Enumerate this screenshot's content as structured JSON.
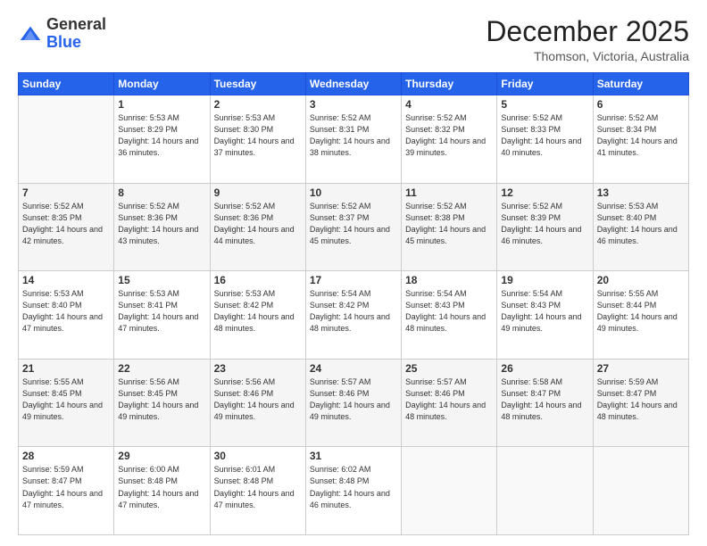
{
  "header": {
    "logo_general": "General",
    "logo_blue": "Blue",
    "month_title": "December 2025",
    "location": "Thomson, Victoria, Australia"
  },
  "weekdays": [
    "Sunday",
    "Monday",
    "Tuesday",
    "Wednesday",
    "Thursday",
    "Friday",
    "Saturday"
  ],
  "weeks": [
    [
      {
        "day": "",
        "sunrise": "",
        "sunset": "",
        "daylight": ""
      },
      {
        "day": "1",
        "sunrise": "5:53 AM",
        "sunset": "8:29 PM",
        "daylight": "14 hours and 36 minutes."
      },
      {
        "day": "2",
        "sunrise": "5:53 AM",
        "sunset": "8:30 PM",
        "daylight": "14 hours and 37 minutes."
      },
      {
        "day": "3",
        "sunrise": "5:52 AM",
        "sunset": "8:31 PM",
        "daylight": "14 hours and 38 minutes."
      },
      {
        "day": "4",
        "sunrise": "5:52 AM",
        "sunset": "8:32 PM",
        "daylight": "14 hours and 39 minutes."
      },
      {
        "day": "5",
        "sunrise": "5:52 AM",
        "sunset": "8:33 PM",
        "daylight": "14 hours and 40 minutes."
      },
      {
        "day": "6",
        "sunrise": "5:52 AM",
        "sunset": "8:34 PM",
        "daylight": "14 hours and 41 minutes."
      }
    ],
    [
      {
        "day": "7",
        "sunrise": "5:52 AM",
        "sunset": "8:35 PM",
        "daylight": "14 hours and 42 minutes."
      },
      {
        "day": "8",
        "sunrise": "5:52 AM",
        "sunset": "8:36 PM",
        "daylight": "14 hours and 43 minutes."
      },
      {
        "day": "9",
        "sunrise": "5:52 AM",
        "sunset": "8:36 PM",
        "daylight": "14 hours and 44 minutes."
      },
      {
        "day": "10",
        "sunrise": "5:52 AM",
        "sunset": "8:37 PM",
        "daylight": "14 hours and 45 minutes."
      },
      {
        "day": "11",
        "sunrise": "5:52 AM",
        "sunset": "8:38 PM",
        "daylight": "14 hours and 45 minutes."
      },
      {
        "day": "12",
        "sunrise": "5:52 AM",
        "sunset": "8:39 PM",
        "daylight": "14 hours and 46 minutes."
      },
      {
        "day": "13",
        "sunrise": "5:53 AM",
        "sunset": "8:40 PM",
        "daylight": "14 hours and 46 minutes."
      }
    ],
    [
      {
        "day": "14",
        "sunrise": "5:53 AM",
        "sunset": "8:40 PM",
        "daylight": "14 hours and 47 minutes."
      },
      {
        "day": "15",
        "sunrise": "5:53 AM",
        "sunset": "8:41 PM",
        "daylight": "14 hours and 47 minutes."
      },
      {
        "day": "16",
        "sunrise": "5:53 AM",
        "sunset": "8:42 PM",
        "daylight": "14 hours and 48 minutes."
      },
      {
        "day": "17",
        "sunrise": "5:54 AM",
        "sunset": "8:42 PM",
        "daylight": "14 hours and 48 minutes."
      },
      {
        "day": "18",
        "sunrise": "5:54 AM",
        "sunset": "8:43 PM",
        "daylight": "14 hours and 48 minutes."
      },
      {
        "day": "19",
        "sunrise": "5:54 AM",
        "sunset": "8:43 PM",
        "daylight": "14 hours and 49 minutes."
      },
      {
        "day": "20",
        "sunrise": "5:55 AM",
        "sunset": "8:44 PM",
        "daylight": "14 hours and 49 minutes."
      }
    ],
    [
      {
        "day": "21",
        "sunrise": "5:55 AM",
        "sunset": "8:45 PM",
        "daylight": "14 hours and 49 minutes."
      },
      {
        "day": "22",
        "sunrise": "5:56 AM",
        "sunset": "8:45 PM",
        "daylight": "14 hours and 49 minutes."
      },
      {
        "day": "23",
        "sunrise": "5:56 AM",
        "sunset": "8:46 PM",
        "daylight": "14 hours and 49 minutes."
      },
      {
        "day": "24",
        "sunrise": "5:57 AM",
        "sunset": "8:46 PM",
        "daylight": "14 hours and 49 minutes."
      },
      {
        "day": "25",
        "sunrise": "5:57 AM",
        "sunset": "8:46 PM",
        "daylight": "14 hours and 48 minutes."
      },
      {
        "day": "26",
        "sunrise": "5:58 AM",
        "sunset": "8:47 PM",
        "daylight": "14 hours and 48 minutes."
      },
      {
        "day": "27",
        "sunrise": "5:59 AM",
        "sunset": "8:47 PM",
        "daylight": "14 hours and 48 minutes."
      }
    ],
    [
      {
        "day": "28",
        "sunrise": "5:59 AM",
        "sunset": "8:47 PM",
        "daylight": "14 hours and 47 minutes."
      },
      {
        "day": "29",
        "sunrise": "6:00 AM",
        "sunset": "8:48 PM",
        "daylight": "14 hours and 47 minutes."
      },
      {
        "day": "30",
        "sunrise": "6:01 AM",
        "sunset": "8:48 PM",
        "daylight": "14 hours and 47 minutes."
      },
      {
        "day": "31",
        "sunrise": "6:02 AM",
        "sunset": "8:48 PM",
        "daylight": "14 hours and 46 minutes."
      },
      {
        "day": "",
        "sunrise": "",
        "sunset": "",
        "daylight": ""
      },
      {
        "day": "",
        "sunrise": "",
        "sunset": "",
        "daylight": ""
      },
      {
        "day": "",
        "sunrise": "",
        "sunset": "",
        "daylight": ""
      }
    ]
  ],
  "labels": {
    "sunrise": "Sunrise:",
    "sunset": "Sunset:",
    "daylight": "Daylight:"
  },
  "colors": {
    "header_bg": "#2563eb",
    "shaded_row": "#f5f5f5"
  }
}
